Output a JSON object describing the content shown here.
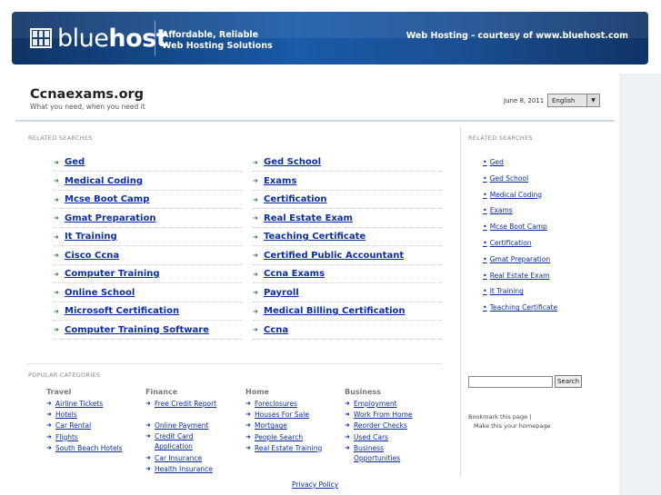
{
  "banner": {
    "logo_light": "blue",
    "logo_bold": "host",
    "tagline_line1": "Affordable, Reliable",
    "tagline_line2": "Web Hosting Solutions",
    "courtesy": "Web Hosting - courtesy of www.bluehost.com"
  },
  "header": {
    "title": "Ccnaexams.org",
    "subtitle": "What you need, when you need it",
    "date": "June 8, 2011",
    "language": "English"
  },
  "related": {
    "label": "RELATED SEARCHES",
    "left": [
      "Ged",
      "Medical Coding",
      "Mcse Boot Camp",
      "Gmat Preparation",
      "It Training",
      "Cisco Ccna",
      "Computer Training",
      "Online School",
      "Microsoft Certification",
      "Computer Training Software"
    ],
    "right": [
      "Ged School",
      "Exams",
      "Certification",
      "Real Estate Exam",
      "Teaching Certificate",
      "Certified Public Accountant",
      "Ccna Exams",
      "Payroll",
      "Medical Billing Certification",
      "Ccna"
    ]
  },
  "sidebar": {
    "label": "RELATED SEARCHES",
    "items": [
      "Ged",
      "Ged School",
      "Medical Coding",
      "Exams",
      "Mcse Boot Camp",
      "Certification",
      "Gmat Preparation",
      "Real Estate Exam",
      "It Training",
      "Teaching Certificate"
    ],
    "search_button": "Search",
    "bookmark": "Bookmark this page",
    "homepage": "Make this your homepage"
  },
  "popular": {
    "label": "POPULAR CATEGORIES",
    "categories": [
      {
        "name": "Travel",
        "items": [
          "Airline Tickets",
          "Hotels",
          "Car Rental",
          "Flights",
          "South Beach Hotels"
        ]
      },
      {
        "name": "Finance",
        "items": [
          "Free Credit Report",
          "Online Payment",
          "Credit Card Application",
          "Car Insurance",
          "Health Insurance"
        ]
      },
      {
        "name": "Home",
        "items": [
          "Foreclosures",
          "Houses For Sale",
          "Mortgage",
          "People Search",
          "Real Estate Training"
        ]
      },
      {
        "name": "Business",
        "items": [
          "Employment",
          "Work From Home",
          "Reorder Checks",
          "Used Cars",
          "Business Opportunities"
        ]
      }
    ]
  },
  "footer": {
    "privacy": "Privacy Policy"
  },
  "colors": {
    "link": "#0b2ea8",
    "banner_dark": "#0f3466",
    "banner_mid": "#1a5aa8",
    "arrow": "#2a7a2a"
  }
}
